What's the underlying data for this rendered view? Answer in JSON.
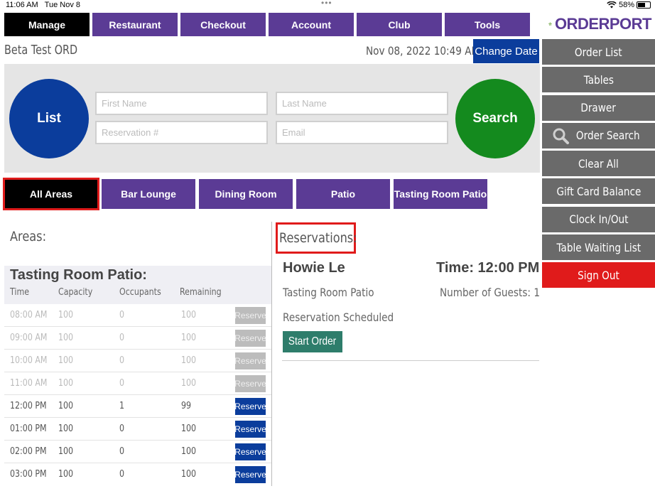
{
  "status_bar": {
    "time": "11:06 AM",
    "date": "Tue Nov 8",
    "battery": "58%",
    "battery_level": 0.58
  },
  "nav": {
    "tabs": [
      "Manage",
      "Restaurant",
      "Checkout",
      "Account",
      "Club",
      "Tools"
    ],
    "active": "Manage"
  },
  "logo": {
    "text": "ORDERPORT"
  },
  "header": {
    "location": "Beta Test ORD",
    "datetime": "Nov 08, 2022 10:49 AM",
    "change_date_label": "Change Date"
  },
  "search_panel": {
    "list_label": "List",
    "search_label": "Search",
    "first_name_placeholder": "First Name",
    "last_name_placeholder": "Last Name",
    "reservation_placeholder": "Reservation #",
    "email_placeholder": "Email"
  },
  "area_tabs": [
    "All Areas",
    "Bar Lounge",
    "Dining Room",
    "Patio",
    "Tasting Room Patio"
  ],
  "sidebar": {
    "items": [
      "Order List",
      "Tables",
      "Drawer",
      "Order Search",
      "Clear All",
      "Gift Card Balance",
      "Clock In/Out",
      "Table Waiting List"
    ],
    "sign_out": "Sign Out"
  },
  "areas": {
    "title": "Areas:",
    "area_name": "Tasting Room Patio:",
    "columns": [
      "Time",
      "Capacity",
      "Occupants",
      "Remaining"
    ],
    "rows": [
      {
        "time": "08:00 AM",
        "capacity": "100",
        "occupants": "0",
        "remaining": "100",
        "action": "Reserve"
      },
      {
        "time": "09:00 AM",
        "capacity": "100",
        "occupants": "0",
        "remaining": "100",
        "action": "Reserve"
      },
      {
        "time": "10:00 AM",
        "capacity": "100",
        "occupants": "0",
        "remaining": "100",
        "action": "Reserve"
      },
      {
        "time": "11:00 AM",
        "capacity": "100",
        "occupants": "0",
        "remaining": "100",
        "action": "Reserve"
      },
      {
        "time": "12:00 PM",
        "capacity": "100",
        "occupants": "1",
        "remaining": "99",
        "action": "Reserve"
      },
      {
        "time": "01:00 PM",
        "capacity": "100",
        "occupants": "0",
        "remaining": "100",
        "action": "Reserve"
      },
      {
        "time": "02:00 PM",
        "capacity": "100",
        "occupants": "0",
        "remaining": "100",
        "action": "Reserve"
      },
      {
        "time": "03:00 PM",
        "capacity": "100",
        "occupants": "0",
        "remaining": "100",
        "action": "Reserve"
      }
    ]
  },
  "reservations": {
    "title": "Reservations:",
    "guest_name": "Howie Le",
    "time": "Time: 12:00 PM",
    "area": "Tasting Room Patio",
    "guests": "Number of Guests: 1",
    "status": "Reservation Scheduled",
    "start_order_label": "Start Order"
  },
  "colors": {
    "nav_purple": "#5b3b95",
    "action_blue": "#0b3d9c",
    "search_green": "#148a1e",
    "sidebar_gray": "#6a6a6a",
    "sign_out_red": "#e01b1b",
    "start_order_teal": "#2e7d6b"
  }
}
